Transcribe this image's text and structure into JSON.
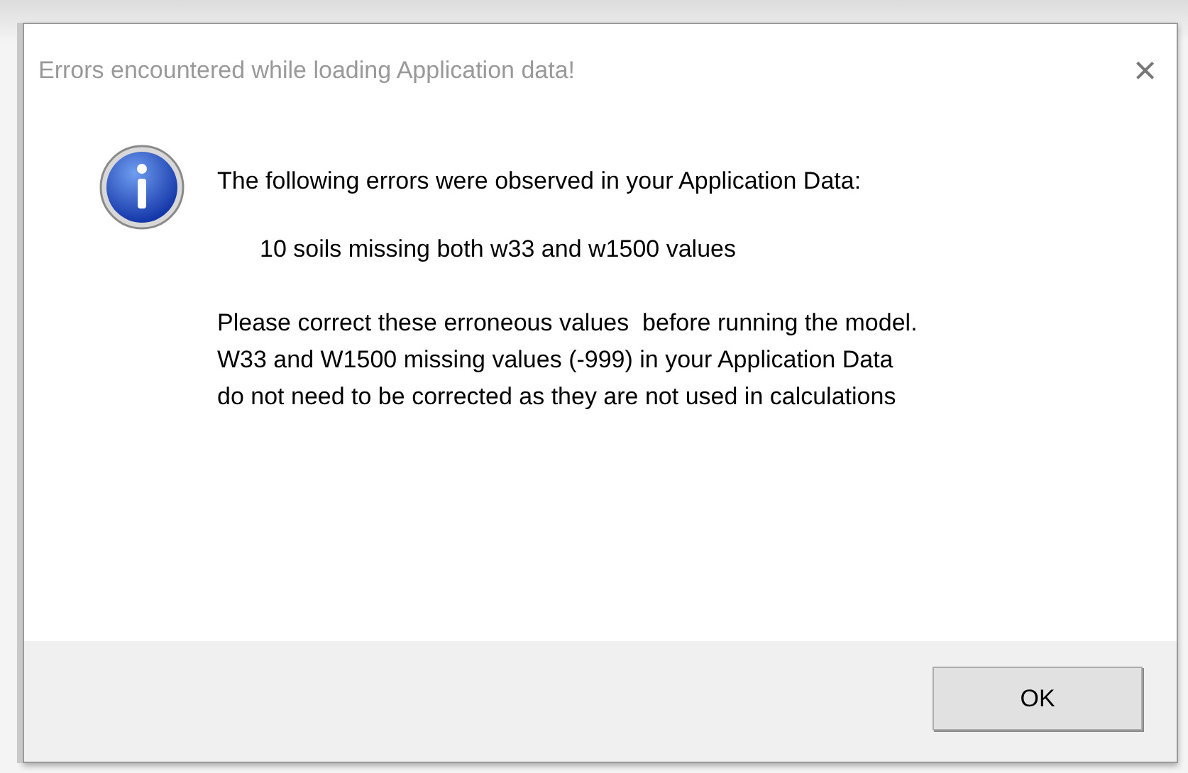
{
  "window": {
    "title": "Errors encountered while loading Application data!",
    "close": "×"
  },
  "message": {
    "heading": "The following errors were observed in your Application Data:",
    "detail": "10 soils missing both w33 and w1500 values",
    "notes": [
      "Please correct these erroneous values  before running the model.",
      "W33 and W1500 missing values (-999) in your Application Data",
      "do not need to be corrected as they are not used in calculations"
    ]
  },
  "buttons": [
    "OK"
  ]
}
